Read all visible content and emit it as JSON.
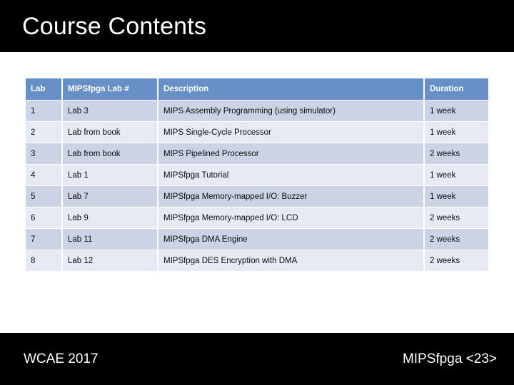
{
  "slide": {
    "title": "Course Contents",
    "colors": {
      "banner_background": "#000000",
      "banner_text": "#ffffff",
      "table_header_background": "#6690C6",
      "table_header_text": "#ffffff",
      "row_odd_background": "#CBD3E5",
      "row_even_background": "#E6EAF3",
      "row_text": "#0d0d0d",
      "slide_background": "#ffffff"
    }
  },
  "table": {
    "columns": [
      {
        "key": "lab",
        "label": "Lab"
      },
      {
        "key": "mipsfpga_lab",
        "label": "MIPSfpga Lab #"
      },
      {
        "key": "description",
        "label": "Description"
      },
      {
        "key": "duration",
        "label": "Duration"
      }
    ],
    "rows": [
      {
        "lab": "1",
        "mipsfpga_lab": "Lab 3",
        "description": "MIPS Assembly Programming (using simulator)",
        "duration": "1 week"
      },
      {
        "lab": "2",
        "mipsfpga_lab": "Lab from book",
        "description": "MIPS Single-Cycle Processor",
        "duration": "1 week"
      },
      {
        "lab": "3",
        "mipsfpga_lab": "Lab from book",
        "description": "MIPS Pipelined Processor",
        "duration": "2 weeks"
      },
      {
        "lab": "4",
        "mipsfpga_lab": "Lab 1",
        "description": "MIPSfpga Tutorial",
        "duration": "1 week"
      },
      {
        "lab": "5",
        "mipsfpga_lab": "Lab 7",
        "description": "MIPSfpga Memory-mapped I/O: Buzzer",
        "duration": "1 week"
      },
      {
        "lab": "6",
        "mipsfpga_lab": "Lab 9",
        "description": "MIPSfpga Memory-mapped I/O: LCD",
        "duration": "2 weeks"
      },
      {
        "lab": "7",
        "mipsfpga_lab": "Lab 11",
        "description": "MIPSfpga DMA Engine",
        "duration": "2 weeks"
      },
      {
        "lab": "8",
        "mipsfpga_lab": "Lab 12",
        "description": "MIPSfpga DES Encryption with DMA",
        "duration": "2 weeks"
      }
    ]
  },
  "footer": {
    "left": "WCAE 2017",
    "right": "MIPSfpga <23>"
  }
}
